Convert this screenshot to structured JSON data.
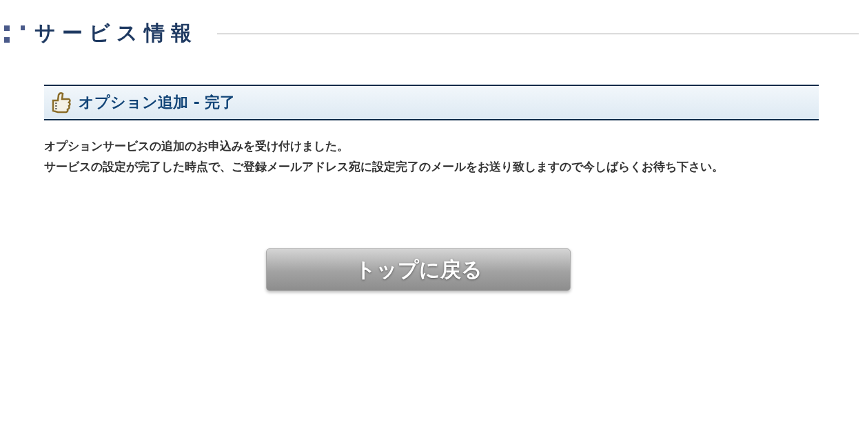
{
  "page_title": "サービス情報",
  "section": {
    "title": "オプション追加 - 完了"
  },
  "message": [
    "オプションサービスの追加のお申込みを受け付けました。",
    "サービスの設定が完了した時点で、ご登録メールアドレス宛に設定完了のメールをお送り致しますので今しばらくお待ち下さい。"
  ],
  "button": {
    "label": "トップに戻る"
  }
}
